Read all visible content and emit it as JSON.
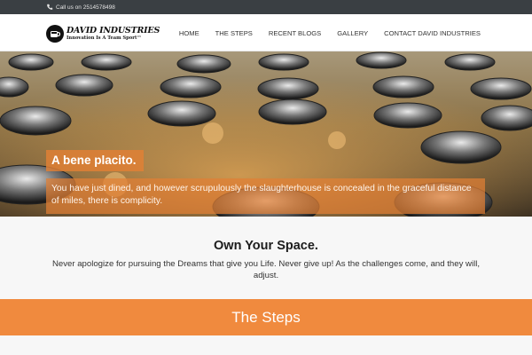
{
  "topbar": {
    "phone_text": "Call us on 2514578498",
    "icon": "phone-icon"
  },
  "brand": {
    "name": "DAVID INDUSTRIES",
    "tagline": "Innovation Is A Team Sport™",
    "logo_icon": "coffee-cup-icon"
  },
  "nav": {
    "items": [
      {
        "label": "HOME"
      },
      {
        "label": "THE STEPS"
      },
      {
        "label": "RECENT BLOGS"
      },
      {
        "label": "GALLERY"
      },
      {
        "label": "CONTACT DAVID INDUSTRIES"
      }
    ]
  },
  "hero": {
    "title": "A bene placito.",
    "text": "You have just dined, and however scrupulously the slaughterhouse is concealed in the graceful distance of miles, there is complicity."
  },
  "intro": {
    "title": "Own Your Space.",
    "text": "Never apologize for pursuing the Dreams that give you Life. Never give up! As the challenges come, and they will, adjust."
  },
  "steps_band": {
    "title": "The Steps"
  },
  "colors": {
    "accent": "#f08a3e",
    "topbar": "#3a3f43",
    "header": "#ffffff"
  }
}
